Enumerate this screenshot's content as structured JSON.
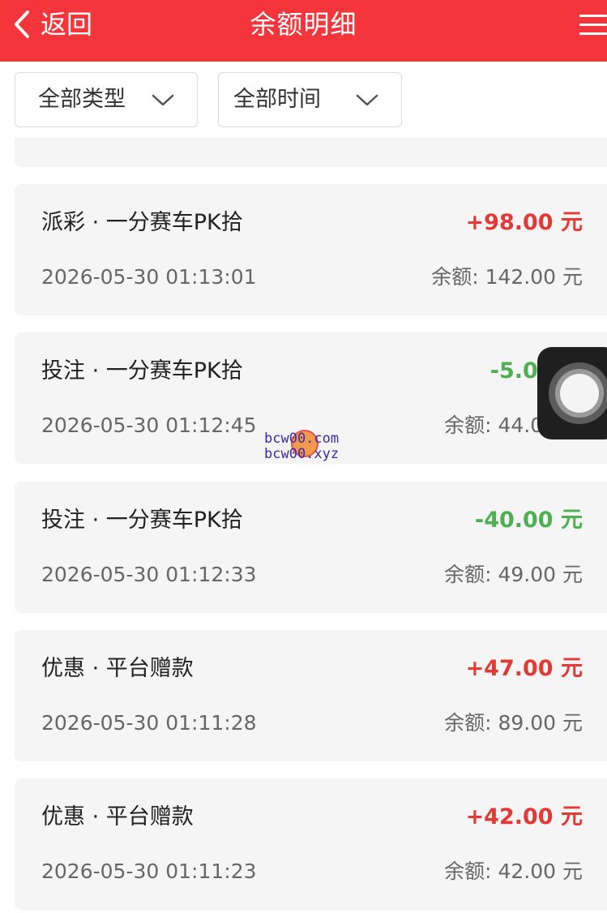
{
  "header": {
    "back_label": "返回",
    "title": "余额明细",
    "menu_icon": "hamburger-menu-icon",
    "background_color": "#f4363c"
  },
  "filters": {
    "type_label": "全部类型",
    "time_label": "全部时间"
  },
  "colors": {
    "positive": "#e53935",
    "negative": "#4caf50"
  },
  "records": [
    {
      "title": "派彩 · 一分赛车PK拾",
      "amount": "+98.00 元",
      "time": "2026-05-30 01:13:01",
      "balance": "余额: 142.00 元",
      "sign": "positive"
    },
    {
      "title": "投注 · 一分赛车PK拾",
      "amount": "-5.00 元",
      "time": "2026-05-30 01:12:45",
      "balance": "余额: 44.00 元",
      "sign": "negative"
    },
    {
      "title": "投注 · 一分赛车PK拾",
      "amount": "-40.00 元",
      "time": "2026-05-30 01:12:33",
      "balance": "余额: 49.00 元",
      "sign": "negative"
    },
    {
      "title": "优惠 · 平台赠款",
      "amount": "+47.00 元",
      "time": "2026-05-30 01:11:28",
      "balance": "余额: 89.00 元",
      "sign": "positive"
    },
    {
      "title": "优惠 · 平台赠款",
      "amount": "+42.00 元",
      "time": "2026-05-30 01:11:23",
      "balance": "余额: 42.00 元",
      "sign": "positive"
    }
  ],
  "watermark": {
    "line1": "bcw00.com",
    "line2": "bcw00.xyz"
  }
}
